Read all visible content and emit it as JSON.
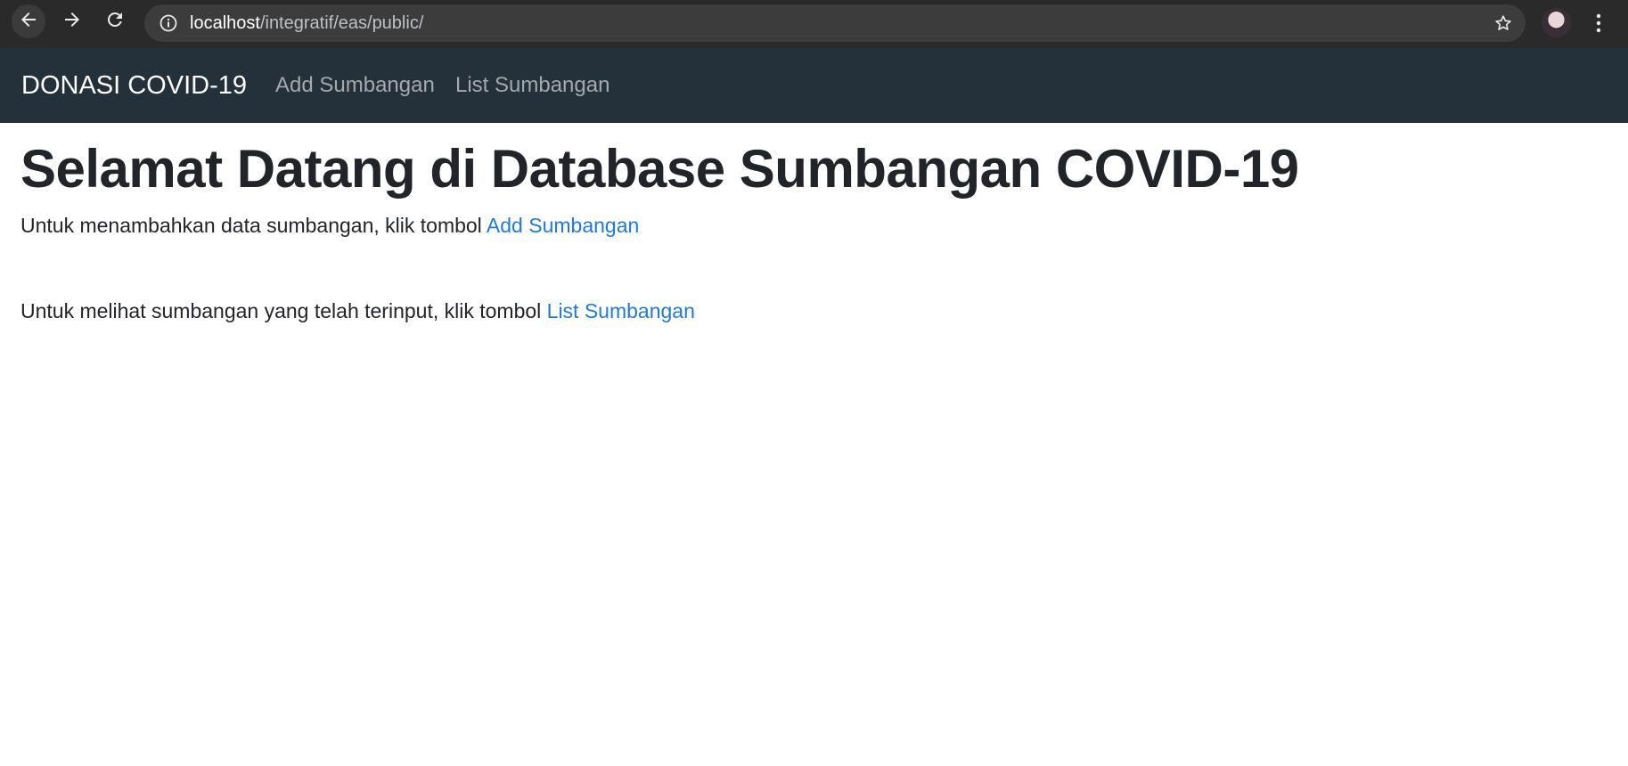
{
  "browser": {
    "url_host": "localhost",
    "url_path": "/integratif/eas/public/",
    "icons": {
      "back": "arrow-left-icon",
      "forward": "arrow-right-icon",
      "reload": "reload-icon",
      "info": "info-icon",
      "bookmark": "star-icon",
      "menu": "kebab-menu-icon"
    }
  },
  "navbar": {
    "brand": "DONASI COVID-19",
    "links": [
      {
        "label": "Add Sumbangan"
      },
      {
        "label": "List Sumbangan"
      }
    ],
    "background": "#24303a"
  },
  "main": {
    "title": "Selamat Datang di Database Sumbangan COVID-19",
    "paragraph1": {
      "text": "Untuk menambahkan data sumbangan, klik tombol ",
      "link": "Add Sumbangan"
    },
    "paragraph2": {
      "text": "Untuk melihat sumbangan yang telah terinput, klik tombol ",
      "link": "List Sumbangan"
    },
    "link_color": "#1f7ae0"
  }
}
